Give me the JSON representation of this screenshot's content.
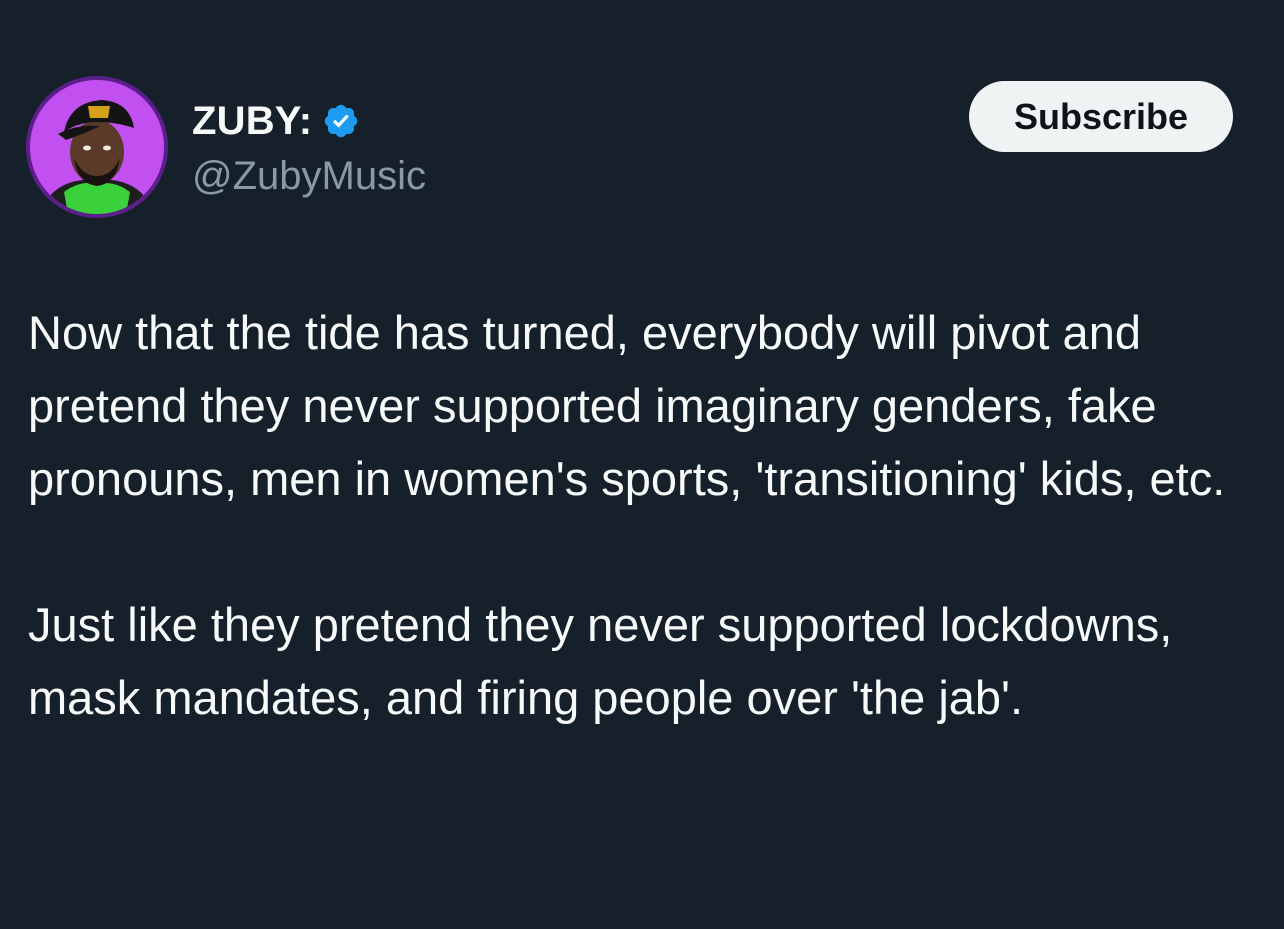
{
  "theme": {
    "background": "#15202b",
    "text": "#f7f9f9",
    "muted": "#8b98a5",
    "verified_blue": "#1d9bf0",
    "button_bg": "#eff3f4"
  },
  "author": {
    "display_name": "ZUBY:",
    "handle": "@ZubyMusic",
    "verified": true,
    "avatar_icon": "avatar-photo"
  },
  "actions": {
    "subscribe_label": "Subscribe"
  },
  "tweet": {
    "paragraphs": [
      "Now that the tide has turned, everybody will pivot and pretend they never supported imaginary genders, fake pronouns, men in women's sports, 'transitioning' kids, etc.",
      "Just like they pretend they never supported lockdowns, mask mandates, and firing people over 'the jab'."
    ]
  }
}
